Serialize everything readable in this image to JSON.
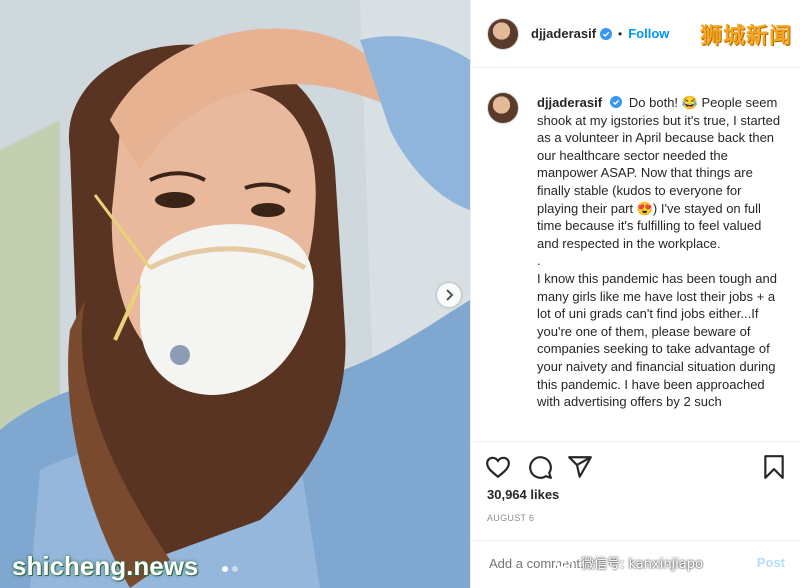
{
  "post": {
    "username": "djjaderasif",
    "follow_label": "Follow",
    "separator": "•",
    "caption": "Do both! 😂 People seem shook at my igstories but it's true, I started as a volunteer in April because back then our healthcare sector needed the manpower ASAP. Now that things are finally stable (kudos to everyone for playing their part 😍) I've stayed on full time because it's fulfilling to feel valued and respected in the workplace.\n.\nI know this pandemic has been tough and many girls like me have lost their jobs + a lot of uni grads can't find jobs either...If you're one of them, please beware of companies seeking to take advantage of your naivety and financial situation during this pandemic. I have been approached with advertising offers by 2 such",
    "likes": "30,964 likes",
    "date": "AUGUST 6",
    "comment_placeholder": "Add a comment...",
    "post_label": "Post"
  },
  "watermarks": {
    "chinese_logo": "狮城新闻",
    "wechat": "微信号: kanxinjiapo",
    "site": "shicheng.news"
  },
  "carousel": {
    "dots": 2,
    "active": 0
  },
  "colors": {
    "accent": "#0095f6",
    "verified": "#3897f0",
    "watermark_orange": "#f5a623"
  },
  "icons": [
    "heart-icon",
    "comment-icon",
    "share-icon",
    "bookmark-icon",
    "verified-badge-icon",
    "chevron-right-icon"
  ]
}
